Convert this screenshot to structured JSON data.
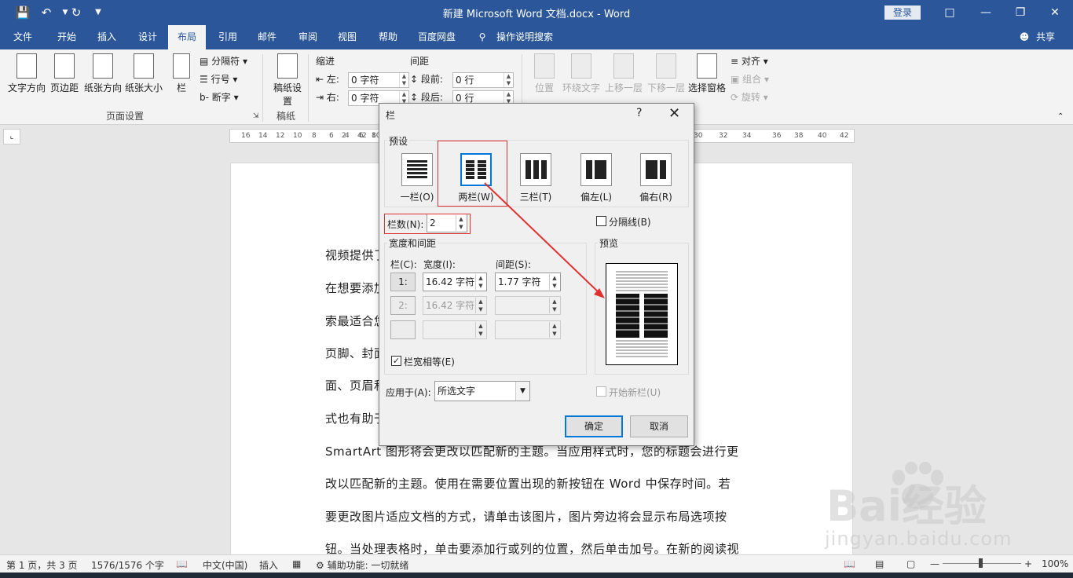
{
  "window": {
    "title": "新建 Microsoft Word 文档.docx  -  Word",
    "login": "登录",
    "share": "共享",
    "tell_me": "操作说明搜索"
  },
  "tabs": [
    "文件",
    "开始",
    "插入",
    "设计",
    "布局",
    "引用",
    "邮件",
    "审阅",
    "视图",
    "帮助",
    "百度网盘"
  ],
  "ribbon": {
    "page_setup": {
      "buttons": [
        "文字方向",
        "页边距",
        "纸张方向",
        "纸张大小",
        "栏"
      ],
      "small": [
        "分隔符",
        "行号",
        "断字"
      ],
      "label": "页面设置"
    },
    "draft": {
      "button": "稿纸设置",
      "label": "稿纸"
    },
    "paragraph": {
      "indent_label": "缩进",
      "spacing_label": "间距",
      "left_label": "左:",
      "right_label": "右:",
      "before_label": "段前:",
      "after_label": "段后:",
      "left_value": "0 字符",
      "right_value": "0 字符",
      "before_value": "0 行",
      "after_value": "0 行"
    },
    "arrange": {
      "buttons": [
        "位置",
        "环绕文字",
        "上移一层",
        "下移一层",
        "选择窗格"
      ],
      "small": [
        "对齐",
        "组合",
        "旋转"
      ]
    }
  },
  "ruler": [
    "16",
    "14",
    "12",
    "10",
    "8",
    "6",
    "4",
    "2",
    "2",
    "4",
    "6",
    "8",
    "10",
    "30",
    "32",
    "34",
    "36",
    "38",
    "40",
    "42"
  ],
  "document": {
    "lines": [
      "视频提供了                                                                              频时，可以",
      "在想要添加                                                                              字以联机搜",
      "索最适合您                                                                              供了页眉、",
      "页脚、封面                                                                              加匹配的封",
      "面、页眉和                                                                              主题和样",
      "式也有助于                                                                              图表或",
      "SmartArt 图形将会更改以匹配新的主题。当应用样式时，您的标题会进行更",
      "改以匹配新的主题。使用在需要位置出现的新按钮在 Word 中保存时间。若",
      "要更改图片适应文档的方式，请单击该图片，图片旁边将会显示布局选项按",
      "钮。当处理表格时，单击要添加行或列的位置，然后单击加号。在新的阅读视"
    ]
  },
  "dialog": {
    "title": "栏",
    "help": "?",
    "presets_label": "预设",
    "presets": [
      "一栏(O)",
      "两栏(W)",
      "三栏(T)",
      "偏左(L)",
      "偏右(R)"
    ],
    "num_columns_label": "栏数(N):",
    "num_columns_value": "2",
    "line_between_label": "分隔线(B)",
    "width_spacing_label": "宽度和间距",
    "col_header": "栏(C):",
    "width_header": "宽度(I):",
    "spacing_header": "间距(S):",
    "rows": [
      {
        "num": "1:",
        "width": "16.42 字符",
        "spacing": "1.77 字符"
      },
      {
        "num": "2:",
        "width": "16.42 字符",
        "spacing": ""
      },
      {
        "num": "",
        "width": "",
        "spacing": ""
      }
    ],
    "equal_width_label": "栏宽相等(E)",
    "equal_width_checked": true,
    "apply_to_label": "应用于(A):",
    "apply_to_value": "所选文字",
    "preview_label": "预览",
    "new_column_label": "开始新栏(U)",
    "ok": "确定",
    "cancel": "取消"
  },
  "statusbar": {
    "page": "第 1 页，共 3 页",
    "words": "1576/1576 个字",
    "lang": "中文(中国)",
    "mode": "插入",
    "accessibility": "辅助功能: 一切就绪",
    "zoom": "100%"
  },
  "watermark": {
    "logo": "Bai经验",
    "url": "jingyan.baidu.com"
  },
  "colors": {
    "accent": "#2b579a",
    "annotation_red": "#e03030"
  }
}
